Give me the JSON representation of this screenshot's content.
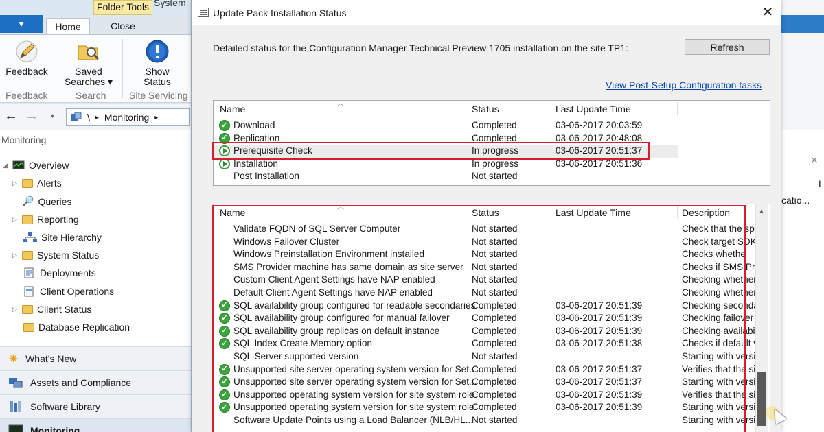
{
  "app": {
    "tabs": {
      "folder_tools": "Folder Tools",
      "system": "System",
      "home": "Home",
      "close": "Close"
    },
    "ribbon": {
      "buttons": [
        {
          "label": "Feedback",
          "icon": "feedback-pencil-icon"
        },
        {
          "label": "Saved Searches ▾",
          "icon": "saved-searches-icon"
        },
        {
          "label": "Show Status",
          "icon": "info-exclamation-icon"
        }
      ],
      "groups": [
        "Feedback",
        "Search",
        "Site Servicing"
      ]
    },
    "nav": {
      "path_sep": "\\",
      "path_arrow": "▸",
      "path_item": "Monitoring",
      "path_end": "▸"
    },
    "left_pane": {
      "title": "Monitoring",
      "tree": [
        "Overview",
        "Alerts",
        "Queries",
        "Reporting",
        "Site Hierarchy",
        "System Status",
        "Deployments",
        "Client Operations",
        "Client Status",
        "Database Replication"
      ],
      "workspaces": [
        "What's New",
        "Assets and Compliance",
        "Software Library",
        "Monitoring"
      ]
    },
    "right_strip": {
      "col_header": "L",
      "cell": "catio..."
    }
  },
  "dialog": {
    "title": "Update Pack Installation Status",
    "close_glyph": "✕",
    "description": "Detailed status for the Configuration Manager Technical Preview 1705 installation on the site TP1:",
    "refresh_label": "Refresh",
    "post_setup_link": "View Post-Setup Configuration tasks",
    "top_grid": {
      "columns": [
        "Name",
        "Status",
        "Last Update Time"
      ],
      "rows": [
        {
          "icon": "check",
          "name": "Download",
          "status": "Completed",
          "time": "03-06-2017 20:03:59"
        },
        {
          "icon": "check",
          "name": "Replication",
          "status": "Completed",
          "time": "03-06-2017 20:48:08"
        },
        {
          "icon": "progress",
          "name": "Prerequisite Check",
          "status": "In progress",
          "time": "03-06-2017 20:51:37"
        },
        {
          "icon": "progress",
          "name": "Installation",
          "status": "In progress",
          "time": "03-06-2017 20:51:36"
        },
        {
          "icon": "none",
          "name": "Post Installation",
          "status": "Not started",
          "time": ""
        }
      ]
    },
    "bottom_grid": {
      "columns": [
        "Name",
        "Status",
        "Last Update Time",
        "Description"
      ],
      "rows": [
        {
          "icon": "none",
          "name": "Validate FQDN of SQL Server Computer",
          "status": "Not started",
          "time": "",
          "desc": "Check that the spe"
        },
        {
          "icon": "none",
          "name": "Windows Failover Cluster",
          "status": "Not started",
          "time": "",
          "desc": "Check target SDK"
        },
        {
          "icon": "none",
          "name": "Windows Preinstallation Environment installed",
          "status": "Not started",
          "time": "",
          "desc": "Checks whethe"
        },
        {
          "icon": "none",
          "name": "SMS Provider machine has same domain as site server",
          "status": "Not started",
          "time": "",
          "desc": "Checks if SMS Pro"
        },
        {
          "icon": "none",
          "name": "Custom Client Agent Settings have NAP enabled",
          "status": "Not started",
          "time": "",
          "desc": "Checking whether"
        },
        {
          "icon": "none",
          "name": "Default Client Agent Settings have NAP enabled",
          "status": "Not started",
          "time": "",
          "desc": "Checking whether"
        },
        {
          "icon": "check",
          "name": "SQL availability group configured for readable secondaries",
          "status": "Completed",
          "time": "03-06-2017 20:51:39",
          "desc": "Checking seconda"
        },
        {
          "icon": "check",
          "name": "SQL availability group configured for manual failover",
          "status": "Completed",
          "time": "03-06-2017 20:51:39",
          "desc": "Checking failover s"
        },
        {
          "icon": "check",
          "name": "SQL availability group replicas on default instance",
          "status": "Completed",
          "time": "03-06-2017 20:51:39",
          "desc": "Checking availabi"
        },
        {
          "icon": "check",
          "name": "SQL Index Create Memory option",
          "status": "Completed",
          "time": "03-06-2017 20:51:38",
          "desc": "Checks if default v"
        },
        {
          "icon": "none",
          "name": "SQL Server supported version",
          "status": "Not started",
          "time": "",
          "desc": "Starting with versi"
        },
        {
          "icon": "check",
          "name": "Unsupported site server operating system version for Set...",
          "status": "Completed",
          "time": "03-06-2017 20:51:37",
          "desc": "Verifies that the site"
        },
        {
          "icon": "check",
          "name": "Unsupported site server operating system version for Set...",
          "status": "Completed",
          "time": "03-06-2017 20:51:37",
          "desc": "Starting with versi"
        },
        {
          "icon": "check",
          "name": "Unsupported operating system version for site system role",
          "status": "Completed",
          "time": "03-06-2017 20:51:39",
          "desc": "Verifies that the site"
        },
        {
          "icon": "check",
          "name": "Unsupported operating system version for site system role",
          "status": "Completed",
          "time": "03-06-2017 20:51:39",
          "desc": "Starting with versi"
        },
        {
          "icon": "none",
          "name": "Software Update Points using a Load Balancer (NLB/HL...",
          "status": "Not started",
          "time": "",
          "desc": "Starting with versi"
        }
      ]
    }
  },
  "colors": {
    "highlight_box": "#d4202a",
    "completed_icon": "#3aa53a",
    "link": "#0645ad"
  }
}
